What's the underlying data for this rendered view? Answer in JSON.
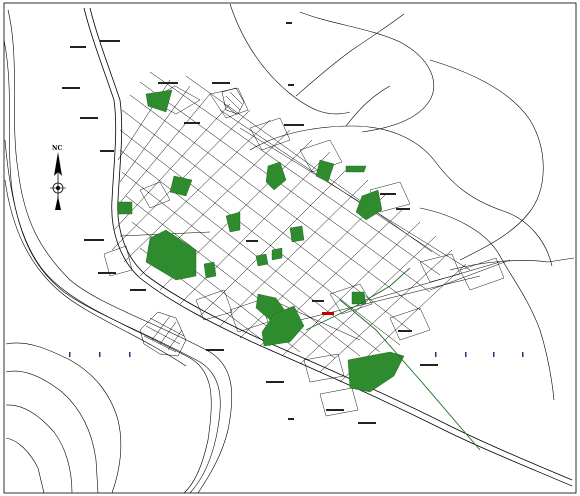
{
  "map": {
    "north_label": "NC",
    "colors": {
      "background": "#ffffff",
      "linework": "#000000",
      "park": "#2e8b2e",
      "accent_red": "#c00000",
      "tick_blue": "#1a3a6b"
    },
    "icons": [
      "north-arrow-icon"
    ]
  }
}
